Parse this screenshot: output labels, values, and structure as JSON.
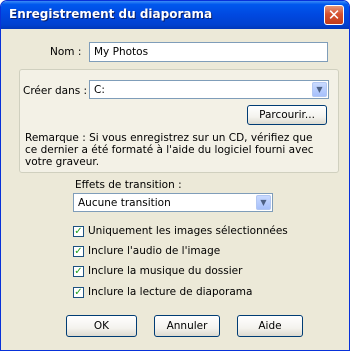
{
  "window": {
    "title": "Enregistrement du diaporama",
    "close_glyph": "✕"
  },
  "form": {
    "name_label": "Nom :",
    "name_value": "My Photos",
    "create_label": "Créer dans :",
    "create_value": "C:",
    "browse_label": "Parcourir...",
    "note": "Remarque : Si vous enregistrez sur un CD, vérifiez que ce dernier a été formaté à l'aide du logiciel fourni avec votre graveur.",
    "transition_label": "Effets de transition :",
    "transition_value": "Aucune transition"
  },
  "checkboxes": [
    {
      "label": "Uniquement les images sélectionnées",
      "checked": true
    },
    {
      "label": "Inclure l'audio de l'image",
      "checked": true
    },
    {
      "label": "Inclure la musique du dossier",
      "checked": true
    },
    {
      "label": "Inclure la lecture de diaporama",
      "checked": true
    }
  ],
  "buttons": {
    "ok": "OK",
    "cancel": "Annuler",
    "help": "Aide"
  }
}
